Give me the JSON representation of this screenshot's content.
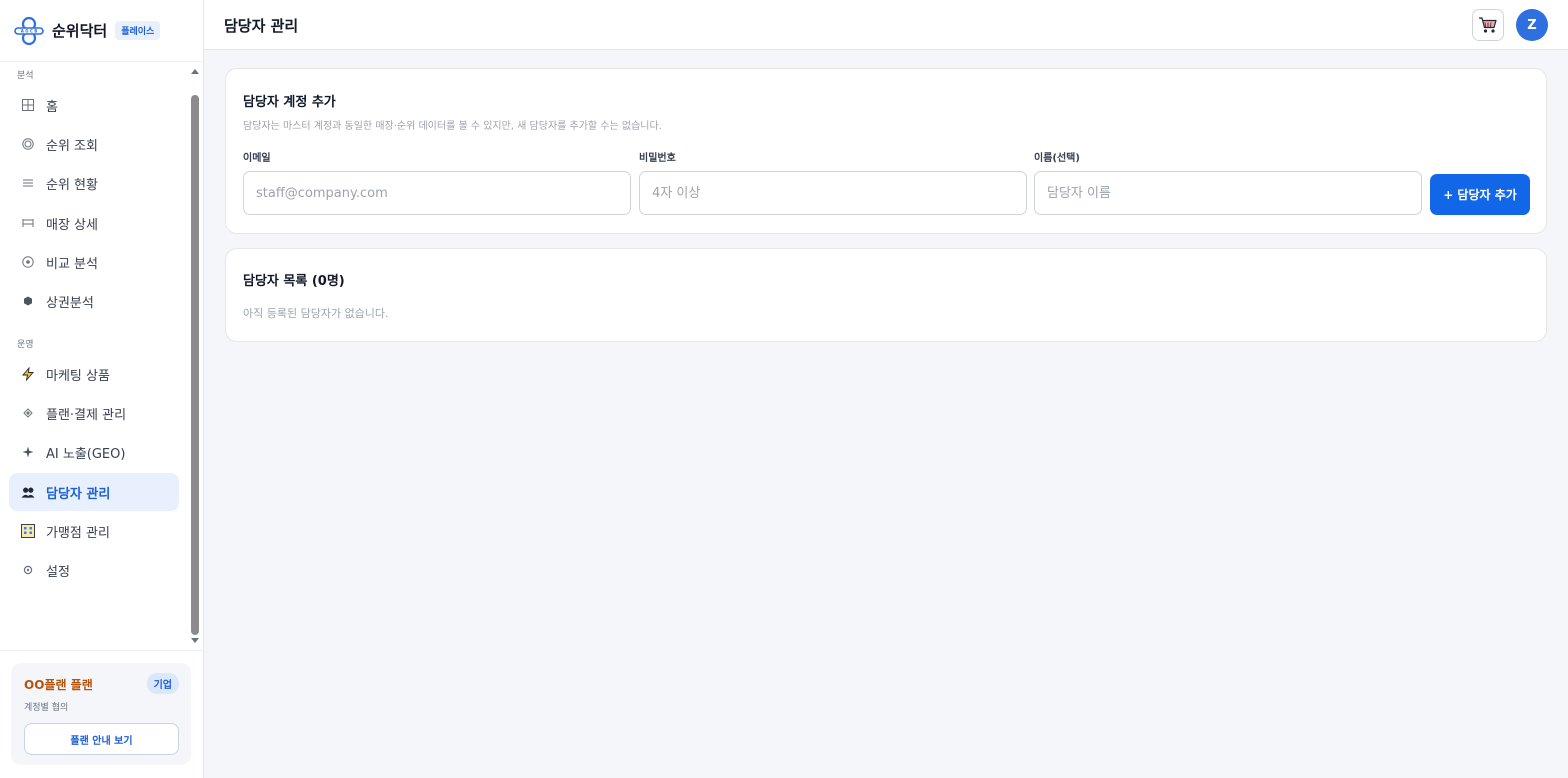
{
  "brand": {
    "name": "순위닥터",
    "badge": "플레이스",
    "logo_text": "A G C B"
  },
  "header": {
    "title": "담당자 관리",
    "avatar_initial": "Z"
  },
  "sidebar": {
    "sections": [
      {
        "label": "분석"
      },
      {
        "label": "운영"
      }
    ],
    "items": [
      {
        "label": "홈",
        "icon": "grid-icon"
      },
      {
        "label": "순위 조회",
        "icon": "circle-icon"
      },
      {
        "label": "순위 현황",
        "icon": "list-icon"
      },
      {
        "label": "매장 상세",
        "icon": "store-icon"
      },
      {
        "label": "비교 분석",
        "icon": "compare-icon"
      },
      {
        "label": "상권분석",
        "icon": "hexagon-icon"
      },
      {
        "label": "마케팅 상품",
        "icon": "lightning-icon"
      },
      {
        "label": "플랜·결제 관리",
        "icon": "diamond-icon"
      },
      {
        "label": "AI 노출(GEO)",
        "icon": "sparkle-icon"
      },
      {
        "label": "담당자 관리",
        "icon": "people-icon",
        "active": true
      },
      {
        "label": "가맹점 관리",
        "icon": "building-icon"
      },
      {
        "label": "설정",
        "icon": "gear-icon"
      }
    ]
  },
  "plan": {
    "name": "OO플랜 플랜",
    "tag": "기업",
    "desc": "계정별 협의",
    "button": "플랜 안내 보기"
  },
  "add_form": {
    "title": "담당자 계정 추가",
    "subtitle": "담당자는 마스터 계정과 동일한 매장·순위 데이터를 볼 수 있지만, 새 담당자를 추가할 수는 없습니다.",
    "email_label": "이메일",
    "email_placeholder": "staff@company.com",
    "password_label": "비밀번호",
    "password_placeholder": "4자 이상",
    "name_label": "이름(선택)",
    "name_placeholder": "담당자 이름",
    "submit": "+ 담당자 추가"
  },
  "list": {
    "title": "담당자 목록 (0명)",
    "empty": "아직 등록된 담당자가 없습니다."
  },
  "colors": {
    "accent": "#1167e8",
    "active_bg": "#e8f0fd",
    "plan_name": "#b45309"
  }
}
